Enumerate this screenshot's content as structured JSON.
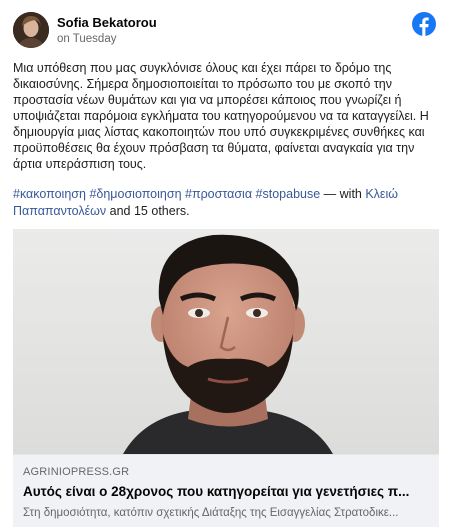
{
  "post": {
    "author": "Sofia Bekatorou",
    "timestamp": "on Tuesday",
    "text": "Μια υπόθεση που μας συγκλόνισε όλους και έχει πάρει το δρόμο της δικαιοσύνης. Σήμερα δημοσιοποιείται το πρόσωπο του με σκοπό την προστασία νέων θυμάτων και για να μπορέσει κάποιος που γνωρίζει ή υποψιάζεται παρόμοια εγκλήματα του κατηγορούμενου να τα καταγγείλει. Η δημιουργία μιας λίστας κακοποιητών που υπό συγκεκριμένες συνθήκες και προϋποθέσεις θα έχουν πρόσβαση τα θύματα, φαίνεται αναγκαία για την άρτια υπεράσπιση τους.",
    "hashtags": [
      "#κακοποιηση",
      "#δημοσιοποιηση",
      "#προστασια",
      "#stopabuse"
    ],
    "with_text": " — with ",
    "tagged_person": "Κλειώ Παπαπαντολέων",
    "and_text": " and ",
    "others": "15 others",
    "period": "."
  },
  "link_preview": {
    "domain": "AGRINIOPRESS.GR",
    "headline": "Αυτός είναι ο 28χρονος που κατηγορείται για γενετήσιες π...",
    "description": "Στη δημοσιότητα, κατόπιν σχετικής Διάταξης της Εισαγγελίας Στρατοδικε..."
  },
  "icons": {
    "brand": "facebook-icon",
    "brand_color": "#1877f2"
  },
  "colors": {
    "link": "#385898",
    "secondary_text": "#65676b",
    "preview_bg": "#f0f2f5"
  }
}
